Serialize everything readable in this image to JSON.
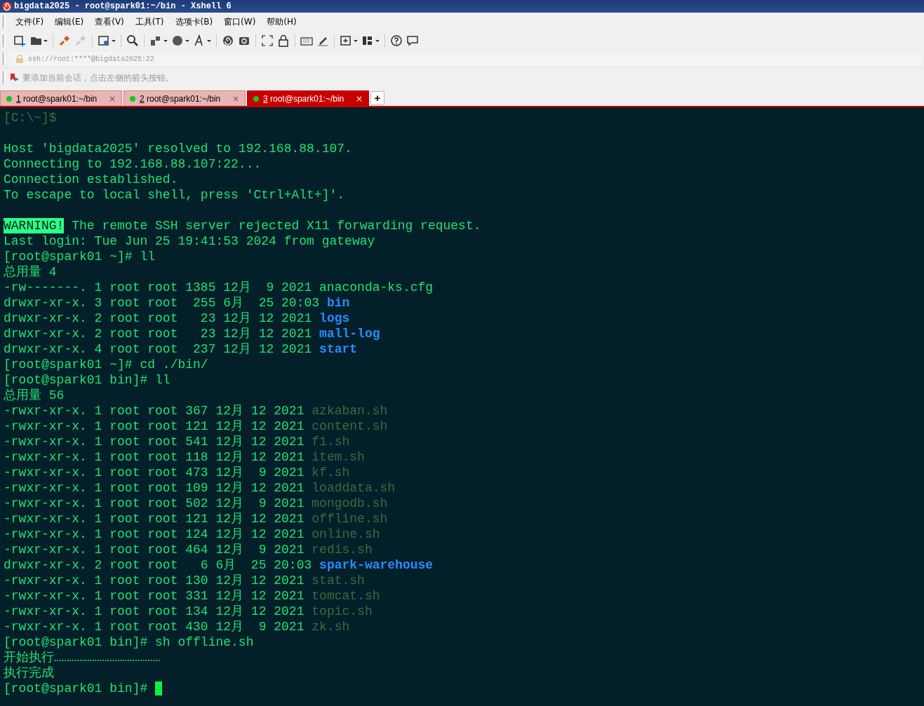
{
  "window": {
    "title": "bigdata2025 - root@spark01:~/bin - Xshell 6"
  },
  "menu": [
    "文件(F)",
    "编辑(E)",
    "查看(V)",
    "工具(T)",
    "选项卡(B)",
    "窗口(W)",
    "帮助(H)"
  ],
  "address_bar": {
    "value": "ssh://root:****@bigdata2025:22"
  },
  "hint_bar": {
    "text": "要添加当前会话，点击左侧的箭头按钮。"
  },
  "tabs": [
    {
      "number": "1",
      "label": " root@spark01:~/bin",
      "close": "×",
      "selected": false
    },
    {
      "number": "2",
      "label": " root@spark01:~/bin",
      "close": "×",
      "selected": false
    },
    {
      "number": "3",
      "label": " root@spark01:~/bin",
      "close": "×",
      "selected": true
    }
  ],
  "new_tab": "+",
  "terminal": {
    "cursor": true,
    "lines": [
      {
        "kind": "text",
        "segments": [
          {
            "kind": "dim",
            "text": "[C:\\~]$"
          }
        ]
      },
      {
        "kind": "blank"
      },
      {
        "kind": "text",
        "segments": [
          {
            "kind": "plain",
            "text": "Host 'bigdata2025' resolved to 192.168.88.107."
          }
        ]
      },
      {
        "kind": "text",
        "segments": [
          {
            "kind": "plain",
            "text": "Connecting to 192.168.88.107:22..."
          }
        ]
      },
      {
        "kind": "text",
        "segments": [
          {
            "kind": "plain",
            "text": "Connection established."
          }
        ]
      },
      {
        "kind": "text",
        "segments": [
          {
            "kind": "plain",
            "text": "To escape to local shell, press 'Ctrl+Alt+]'."
          }
        ]
      },
      {
        "kind": "blank"
      },
      {
        "kind": "text",
        "segments": [
          {
            "kind": "warning",
            "text": "WARNING!"
          },
          {
            "kind": "plain",
            "text": " The remote SSH server rejected X11 forwarding request."
          }
        ]
      },
      {
        "kind": "text",
        "segments": [
          {
            "kind": "plain",
            "text": "Last login: Tue Jun 25 19:41:53 2024 from gateway"
          }
        ]
      },
      {
        "kind": "text",
        "segments": [
          {
            "kind": "plain",
            "text": "[root@spark01 ~]# ll"
          }
        ]
      },
      {
        "kind": "text",
        "segments": [
          {
            "kind": "plain",
            "text": "总用量 4"
          }
        ]
      },
      {
        "kind": "text",
        "segments": [
          {
            "kind": "plain",
            "text": "-rw-------. 1 root root 1385 12月  9 2021 anaconda-ks.cfg"
          }
        ]
      },
      {
        "kind": "text",
        "segments": [
          {
            "kind": "plain",
            "text": "drwxr-xr-x. 3 root root  255 6月  25 20:03 "
          },
          {
            "kind": "dir",
            "text": "bin"
          }
        ]
      },
      {
        "kind": "text",
        "segments": [
          {
            "kind": "plain",
            "text": "drwxr-xr-x. 2 root root   23 12月 12 2021 "
          },
          {
            "kind": "dir",
            "text": "logs"
          }
        ]
      },
      {
        "kind": "text",
        "segments": [
          {
            "kind": "plain",
            "text": "drwxr-xr-x. 2 root root   23 12月 12 2021 "
          },
          {
            "kind": "dir",
            "text": "mall-log"
          }
        ]
      },
      {
        "kind": "text",
        "segments": [
          {
            "kind": "plain",
            "text": "drwxr-xr-x. 4 root root  237 12月 12 2021 "
          },
          {
            "kind": "dir",
            "text": "start"
          }
        ]
      },
      {
        "kind": "text",
        "segments": [
          {
            "kind": "plain",
            "text": "[root@spark01 ~]# cd ./bin/"
          }
        ]
      },
      {
        "kind": "text",
        "segments": [
          {
            "kind": "plain",
            "text": "[root@spark01 bin]# ll"
          }
        ]
      },
      {
        "kind": "text",
        "segments": [
          {
            "kind": "plain",
            "text": "总用量 56"
          }
        ]
      },
      {
        "kind": "text",
        "segments": [
          {
            "kind": "plain",
            "text": "-rwxr-xr-x. 1 root root 367 12月 12 2021 "
          },
          {
            "kind": "dim",
            "text": "azkaban.sh"
          }
        ]
      },
      {
        "kind": "text",
        "segments": [
          {
            "kind": "plain",
            "text": "-rwxr-xr-x. 1 root root 121 12月 12 2021 "
          },
          {
            "kind": "dim",
            "text": "content.sh"
          }
        ]
      },
      {
        "kind": "text",
        "segments": [
          {
            "kind": "plain",
            "text": "-rwxr-xr-x. 1 root root 541 12月 12 2021 "
          },
          {
            "kind": "dim",
            "text": "f1.sh"
          }
        ]
      },
      {
        "kind": "text",
        "segments": [
          {
            "kind": "plain",
            "text": "-rwxr-xr-x. 1 root root 118 12月 12 2021 "
          },
          {
            "kind": "dim",
            "text": "item.sh"
          }
        ]
      },
      {
        "kind": "text",
        "segments": [
          {
            "kind": "plain",
            "text": "-rwxr-xr-x. 1 root root 473 12月  9 2021 "
          },
          {
            "kind": "dim",
            "text": "kf.sh"
          }
        ]
      },
      {
        "kind": "text",
        "segments": [
          {
            "kind": "plain",
            "text": "-rwxr-xr-x. 1 root root 109 12月 12 2021 "
          },
          {
            "kind": "dim",
            "text": "loaddata.sh"
          }
        ]
      },
      {
        "kind": "text",
        "segments": [
          {
            "kind": "plain",
            "text": "-rwxr-xr-x. 1 root root 502 12月  9 2021 "
          },
          {
            "kind": "dim",
            "text": "mongodb.sh"
          }
        ]
      },
      {
        "kind": "text",
        "segments": [
          {
            "kind": "plain",
            "text": "-rwxr-xr-x. 1 root root 121 12月 12 2021 "
          },
          {
            "kind": "dim",
            "text": "offline.sh"
          }
        ]
      },
      {
        "kind": "text",
        "segments": [
          {
            "kind": "plain",
            "text": "-rwxr-xr-x. 1 root root 124 12月 12 2021 "
          },
          {
            "kind": "dim",
            "text": "online.sh"
          }
        ]
      },
      {
        "kind": "text",
        "segments": [
          {
            "kind": "plain",
            "text": "-rwxr-xr-x. 1 root root 464 12月  9 2021 "
          },
          {
            "kind": "dim",
            "text": "redis.sh"
          }
        ]
      },
      {
        "kind": "text",
        "segments": [
          {
            "kind": "plain",
            "text": "drwxr-xr-x. 2 root root   6 6月  25 20:03 "
          },
          {
            "kind": "dir",
            "text": "spark-warehouse"
          }
        ]
      },
      {
        "kind": "text",
        "segments": [
          {
            "kind": "plain",
            "text": "-rwxr-xr-x. 1 root root 130 12月 12 2021 "
          },
          {
            "kind": "dim",
            "text": "stat.sh"
          }
        ]
      },
      {
        "kind": "text",
        "segments": [
          {
            "kind": "plain",
            "text": "-rwxr-xr-x. 1 root root 331 12月 12 2021 "
          },
          {
            "kind": "dim",
            "text": "tomcat.sh"
          }
        ]
      },
      {
        "kind": "text",
        "segments": [
          {
            "kind": "plain",
            "text": "-rwxr-xr-x. 1 root root 134 12月 12 2021 "
          },
          {
            "kind": "dim",
            "text": "topic.sh"
          }
        ]
      },
      {
        "kind": "text",
        "segments": [
          {
            "kind": "plain",
            "text": "-rwxr-xr-x. 1 root root 430 12月  9 2021 "
          },
          {
            "kind": "dim",
            "text": "zk.sh"
          }
        ]
      },
      {
        "kind": "text",
        "segments": [
          {
            "kind": "plain",
            "text": "[root@spark01 bin]# sh offline.sh"
          }
        ]
      },
      {
        "kind": "text",
        "segments": [
          {
            "kind": "plain",
            "text": "开始执行……………………………………"
          }
        ]
      },
      {
        "kind": "text",
        "segments": [
          {
            "kind": "plain",
            "text": "执行完成"
          }
        ]
      },
      {
        "kind": "text",
        "segments": [
          {
            "kind": "plain",
            "text": "[root@spark01 bin]# "
          }
        ]
      }
    ]
  }
}
